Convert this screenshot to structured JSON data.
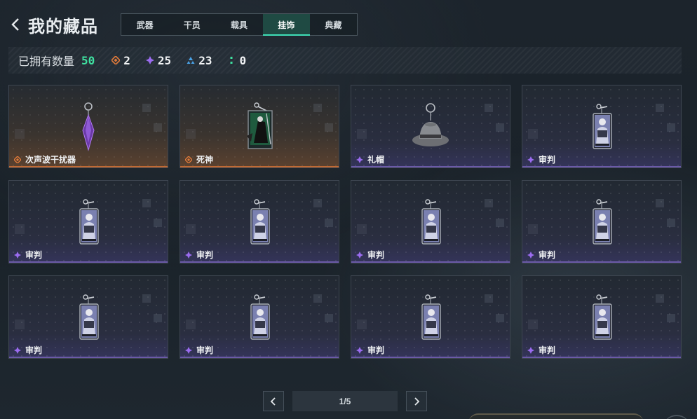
{
  "header": {
    "title": "我的藏品",
    "tabs": [
      {
        "label": "武器",
        "active": false
      },
      {
        "label": "干员",
        "active": false
      },
      {
        "label": "载具",
        "active": false
      },
      {
        "label": "挂饰",
        "active": true
      },
      {
        "label": "典藏",
        "active": false
      }
    ]
  },
  "stats": {
    "owned_label": "已拥有数量",
    "owned_count": "50",
    "tiers": [
      {
        "icon": "orange-diamond-icon",
        "color": "#e07a3a",
        "count": "2"
      },
      {
        "icon": "purple-diamond-icon",
        "color": "#9b6cf0",
        "count": "25"
      },
      {
        "icon": "blue-triangle-icon",
        "color": "#4aa3e8",
        "count": "23"
      },
      {
        "icon": "green-dots-icon",
        "color": "#3fe0a0",
        "count": "0"
      }
    ]
  },
  "items": [
    {
      "name": "次声波干扰器",
      "rarity": "orange",
      "art": "crystal-pendant"
    },
    {
      "name": "死神",
      "rarity": "orange",
      "art": "reaper-card"
    },
    {
      "name": "礼帽",
      "rarity": "purple",
      "art": "fedora-hat"
    },
    {
      "name": "审判",
      "rarity": "purple",
      "art": "judgment-card"
    },
    {
      "name": "审判",
      "rarity": "purple",
      "art": "judgment-card"
    },
    {
      "name": "审判",
      "rarity": "purple",
      "art": "judgment-card"
    },
    {
      "name": "审判",
      "rarity": "purple",
      "art": "judgment-card"
    },
    {
      "name": "审判",
      "rarity": "purple",
      "art": "judgment-card"
    },
    {
      "name": "审判",
      "rarity": "purple",
      "art": "judgment-card"
    },
    {
      "name": "审判",
      "rarity": "purple",
      "art": "judgment-card"
    },
    {
      "name": "审判",
      "rarity": "purple",
      "art": "judgment-card"
    },
    {
      "name": "审判",
      "rarity": "purple",
      "art": "judgment-card"
    }
  ],
  "pagination": {
    "indicator": "1/5",
    "current_page": 1,
    "total_pages": 5
  },
  "colors": {
    "accent_green": "#3fe0a0",
    "rarity_orange": "#e07a3a",
    "rarity_purple": "#9b6cf0"
  }
}
